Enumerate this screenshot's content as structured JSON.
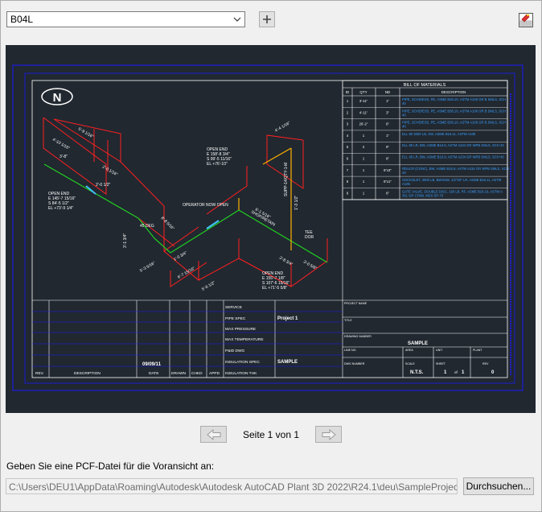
{
  "toolbar": {
    "drawing_select_value": "B04L",
    "drawing_select_icon": "chevron-down-icon",
    "add_icon": "plus-icon",
    "settings_icon": "sheet-settings-icon"
  },
  "preview": {
    "background": "#212830",
    "frame_color": "#1a1aff",
    "pipe_color": "#ff2020",
    "bom_title": "BILL OF MATERIALS",
    "bom_headers": [
      "ID",
      "QTY",
      "ND",
      "DESCRIPTION"
    ],
    "bom_rows": [
      [
        "1",
        "3'-11\"",
        "1\"",
        "PIPE, SCHD/ESS, PE, ASME B36.10, ASTM A106 GR B SMLS, SCH 40"
      ],
      [
        "2",
        "4'-11\"",
        "3\"",
        "PIPE, SCHD/ESS, PE, ASME B36.10, ASTM A106 GR B SMLS, SCH 40"
      ],
      [
        "3",
        "26'-2\"",
        "6\"",
        "PIPE, SCHD/ESS, PE, ASME B36.10, ASTM A106 GR B SMLS, SCH 40"
      ],
      [
        "4",
        "1",
        "1\"",
        "ELL 90 3000 LB, SW, ASME B16.11, ASTM A105"
      ],
      [
        "5",
        "2",
        "6\"",
        "ELL 90 LR, BW, ASME B16.9, ASTM A234 GR WPB SMLS, SCH 40"
      ],
      [
        "6",
        "1",
        "6\"",
        "ELL 45 LR, BW, ASME B16.9, ASTM A234 GR WPB SMLS, SCH 40"
      ],
      [
        "7",
        "1",
        "6\"x3\"",
        "RDUCR (CONC), BW, ASME B16.9, ASTM A234 GR WPB SMLS, SCH 40"
      ],
      [
        "8",
        "1",
        "6\"x1\"",
        "SOCKOLET, 3000 LB, BWXSW, 1/2\"X6\" LR, ASME B16.11, ASTM A105"
      ],
      [
        "9",
        "1",
        "6\"",
        "GATE VALVE, DOUBLE DISC, 150 LB, RF, ASME B16.10, ASTM A 351 GR CF8M, MSS SP-70"
      ]
    ],
    "north_label": "N",
    "annotations": [
      "OPEN END",
      "E 145'-7 15/16\"",
      "S 84'-5 1/2\"",
      "EL +73'-9 1/4\"",
      "OPEN END",
      "E 158'-8 3/4\"",
      "S 99'-5 11/16\"",
      "EL +76'-10\"",
      "OPEN END",
      "E 155'-7 1/8\"",
      "S 107'-6 15/16\"",
      "EL +71'-5 5/8\"",
      "OPERATOR NOW OPEN",
      "5'-9 1/16\"",
      "4'-10 1/16\"",
      "3'-8\"",
      "2'-0 1/16\"",
      "2'-0 1/2\"",
      "8'-8 5/16\"",
      "6'-1 5/16\"",
      "3'-1 3/4\"",
      "5'-3 5/16\"",
      "3'-8 3/4\"",
      "3'-0 5/8\"",
      "1'-0 3/4\"",
      "4'-4 1/16\"",
      "6'-7 15/16\"",
      "5'-6 1/2\"",
      "1'-3 1/2\"",
      "45 DEG",
      "SUPP-14/QTY-1-M",
      "SHOP/RETAIN",
      "TEE",
      "DOR"
    ],
    "title_block": {
      "labels": [
        "SERVICE",
        "PIPE SPEC",
        "MAX PRESSURE",
        "MAX TEMPERATURE",
        "P&ID DWG",
        "INSULATION SPEC",
        "INSULATION THK"
      ],
      "project": "Project 1",
      "insulation_spec": "SAMPLE",
      "date": "09/09/11",
      "rev_headers": [
        "REV.",
        "DESCRIPTION",
        "DATE",
        "DRAWN",
        "CHKD",
        "APPD"
      ],
      "right_labels": [
        "PROJECT NAME",
        "TITLE",
        "DRAWING NUMBER",
        "LINE NO.",
        "AREA",
        "UNIT",
        "PLANT",
        "DWG NUMBER",
        "SCALE",
        "SHEET",
        "REV"
      ],
      "drawing_number": "SAMPLE",
      "scale": "N.T.S.",
      "sheet": "1",
      "sheet_of_word": "of",
      "sheet_of": "1",
      "rev": "0"
    }
  },
  "pager": {
    "label": "Seite 1 von 1",
    "prev_icon": "arrow-left-icon",
    "next_icon": "arrow-right-icon"
  },
  "pcf": {
    "prompt": "Geben Sie eine PCF-Datei für die Voransicht an:",
    "path": "C:\\Users\\DEU1\\AppData\\Roaming\\Autodesk\\Autodesk AutoCAD Plant 3D 2022\\R24.1\\deu\\SampleProjects\\SampleProject\\Isometric\\Sample.pcf",
    "browse_label": "Durchsuchen..."
  }
}
